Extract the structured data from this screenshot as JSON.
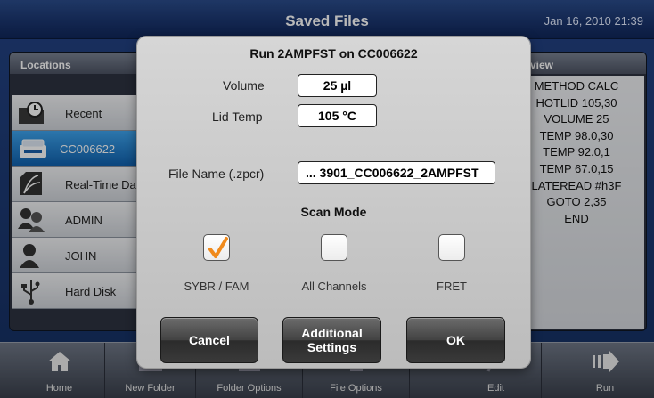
{
  "header": {
    "title": "Saved Files",
    "datetime": "Jan 16, 2010 21:39"
  },
  "locations": {
    "heading": "Locations",
    "items": [
      {
        "label": "Recent",
        "icon": "folder-clock-icon",
        "selected": false
      },
      {
        "label": "CC006622",
        "icon": "instrument-icon",
        "selected": true
      },
      {
        "label": "Real-Time Dat",
        "icon": "realtime-data-icon",
        "selected": false
      },
      {
        "label": "ADMIN",
        "icon": "users-icon",
        "selected": false
      },
      {
        "label": "JOHN",
        "icon": "user-icon",
        "selected": false
      },
      {
        "label": "Hard Disk",
        "icon": "usb-icon",
        "selected": false
      }
    ]
  },
  "preview": {
    "heading": "view",
    "lines": [
      "METHOD CALC",
      "HOTLID 105,30",
      "VOLUME 25",
      "TEMP 98.0,30",
      "TEMP 92.0,1",
      "TEMP 67.0,15",
      "LATEREAD #h3F",
      "GOTO 2,35",
      "END"
    ]
  },
  "toolbar": {
    "buttons": [
      {
        "label": "Home",
        "icon": "home-icon"
      },
      {
        "label": "New Folder",
        "icon": "new-folder-icon"
      },
      {
        "label": "Folder Options",
        "icon": "folder-options-icon"
      },
      {
        "label": "File Options",
        "icon": "file-options-icon"
      },
      {
        "label": "Edit",
        "icon": "edit-icon"
      },
      {
        "label": "Run",
        "icon": "run-icon"
      }
    ]
  },
  "dialog": {
    "title": "Run 2AMPFST on CC006622",
    "volume_label": "Volume",
    "volume_value": "25 µl",
    "lid_label": "Lid Temp",
    "lid_value": "105 °C",
    "filename_label": "File Name (.zpcr)",
    "filename_value": "... 3901_CC006622_2AMPFST",
    "scan_mode_label": "Scan Mode",
    "scan_options": [
      {
        "label": "SYBR / FAM",
        "checked": true
      },
      {
        "label": "All Channels",
        "checked": false
      },
      {
        "label": "FRET",
        "checked": false
      }
    ],
    "check_color": "#f08a1c",
    "buttons": {
      "cancel": "Cancel",
      "additional_line1": "Additional",
      "additional_line2": "Settings",
      "ok": "OK"
    }
  }
}
